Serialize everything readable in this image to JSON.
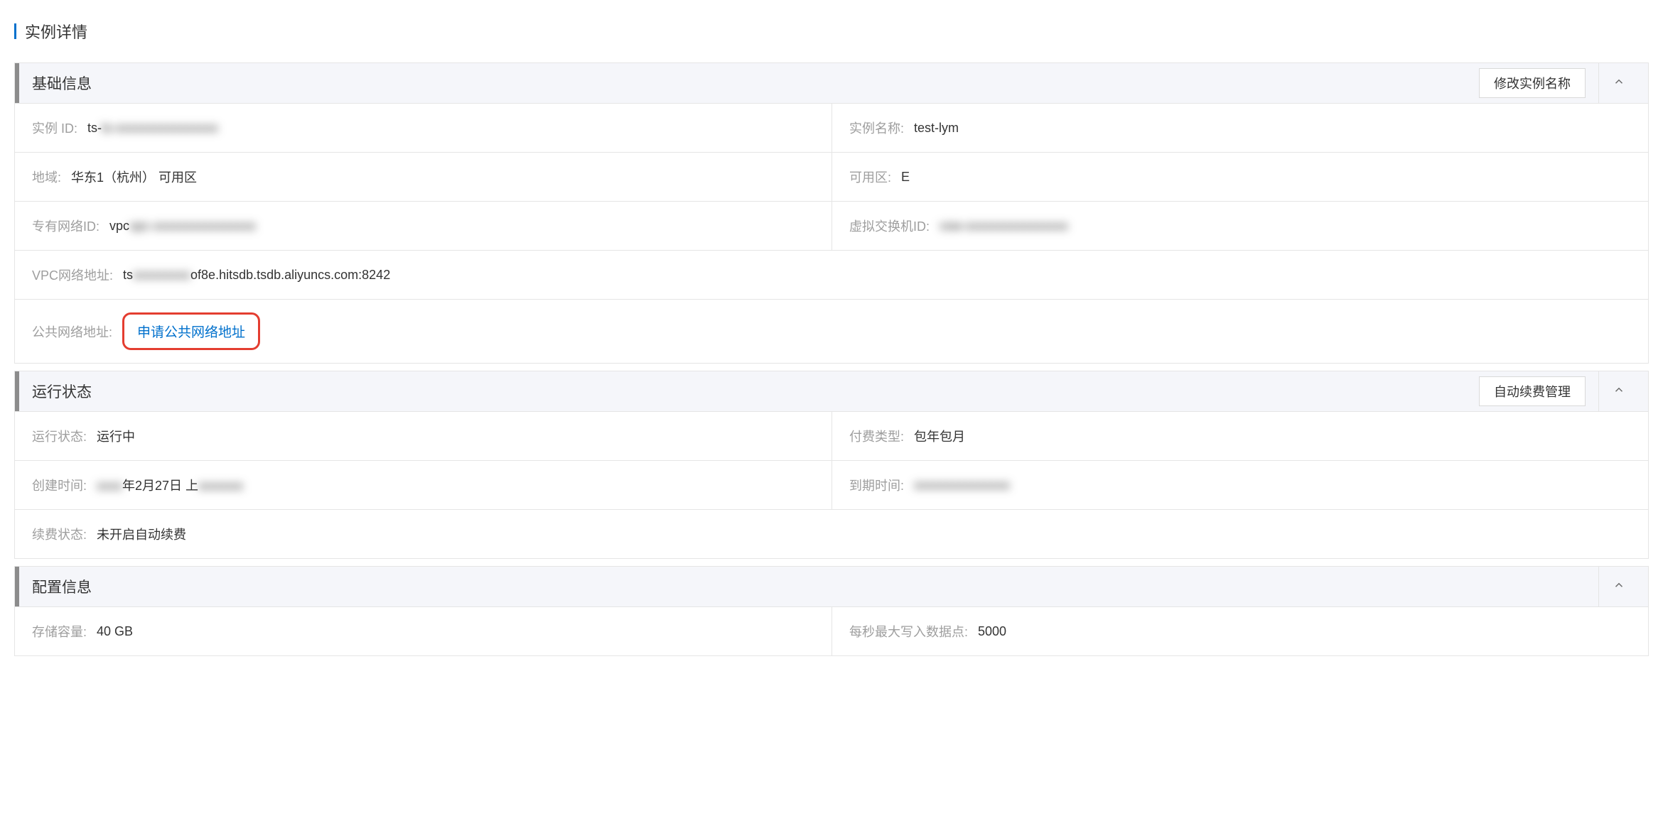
{
  "pageTitle": "实例详情",
  "panels": {
    "basic": {
      "title": "基础信息",
      "action": "修改实例名称",
      "fields": {
        "instanceIdLabel": "实例 ID:",
        "instanceIdValue": "ts-xxxxxxxxxxxxxxxx",
        "instanceNameLabel": "实例名称:",
        "instanceNameValue": "test-lym",
        "regionLabel": "地域:",
        "regionValue": "华东1（杭州）  可用区",
        "zoneLabel": "可用区:",
        "zoneValue": "E",
        "vpcIdLabel": "专有网络ID:",
        "vpcIdValue": "vpc-xxxxxxxxxxxxxxxx",
        "vswitchIdLabel": "虚拟交换机ID:",
        "vswitchIdValue": "vsw-xxxxxxxxxxxxxxxx",
        "vpcAddrLabel": "VPC网络地址:",
        "vpcAddrPrefix": "ts",
        "vpcAddrMid": "xxxxxxxxx",
        "vpcAddrSuffix": "of8e.hitsdb.tsdb.aliyuncs.com:8242",
        "publicAddrLabel": "公共网络地址:",
        "publicAddrAction": "申请公共网络地址"
      }
    },
    "status": {
      "title": "运行状态",
      "action": "自动续费管理",
      "fields": {
        "statusLabel": "运行状态:",
        "statusValue": "运行中",
        "billingLabel": "付费类型:",
        "billingValue": "包年包月",
        "createTimeLabel": "创建时间:",
        "createTimePrefix": "xxxx",
        "createTimeMid": "年2月27日 上",
        "createTimeSuffix": "xxxxxxx",
        "expireTimeLabel": "到期时间:",
        "expireTimeValue": "xxxxxxxxxxxxxxx",
        "renewLabel": "续费状态:",
        "renewValue": "未开启自动续费"
      }
    },
    "config": {
      "title": "配置信息",
      "fields": {
        "storageLabel": "存储容量:",
        "storageValue": "40 GB",
        "wpsLabel": "每秒最大写入数据点:",
        "wpsValue": "5000"
      }
    }
  }
}
